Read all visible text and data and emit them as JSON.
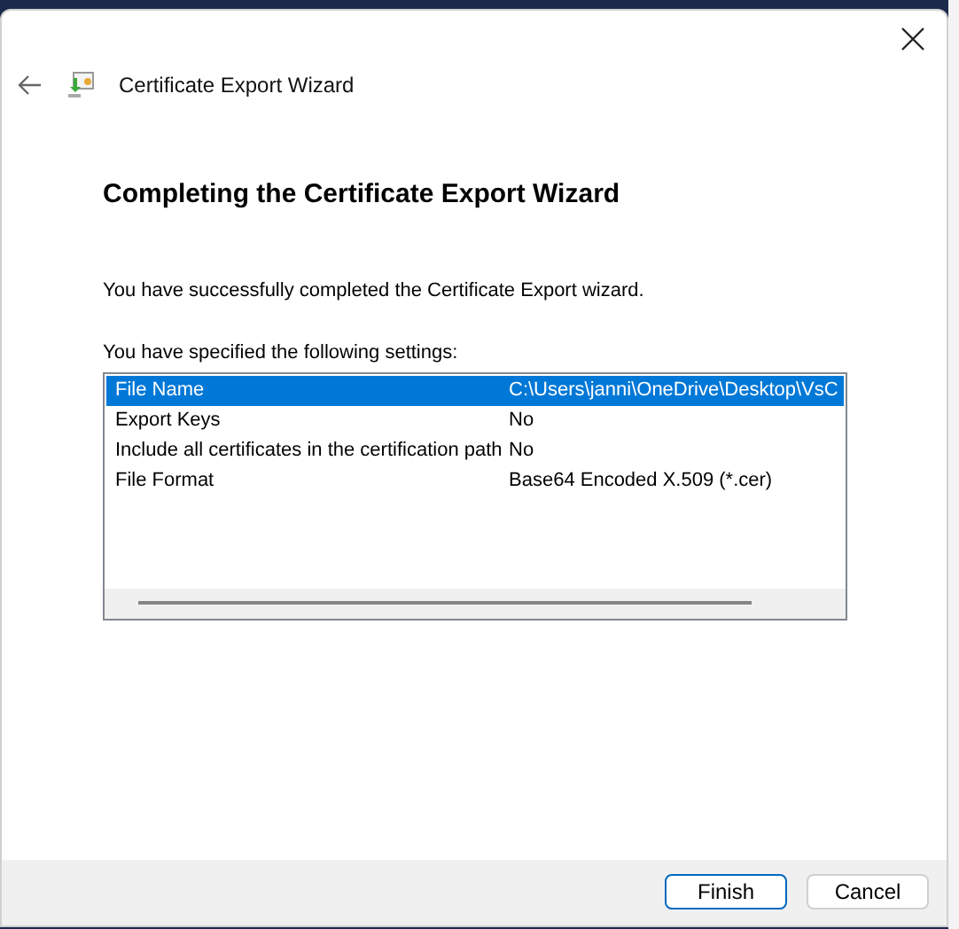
{
  "window": {
    "title": "Certificate Export Wizard"
  },
  "heading": "Completing the Certificate Export Wizard",
  "message": "You have successfully completed the Certificate Export wizard.",
  "settings_label": "You have specified the following settings:",
  "settings": [
    {
      "name": "File Name",
      "value": "C:\\Users\\janni\\OneDrive\\Desktop\\VsC",
      "selected": true
    },
    {
      "name": "Export Keys",
      "value": "No",
      "selected": false
    },
    {
      "name": "Include all certificates in the certification path",
      "value": "No",
      "selected": false
    },
    {
      "name": "File Format",
      "value": "Base64 Encoded X.509 (*.cer)",
      "selected": false
    }
  ],
  "buttons": [
    {
      "label": "Finish",
      "kind": "default"
    },
    {
      "label": "Cancel",
      "kind": "normal"
    }
  ]
}
